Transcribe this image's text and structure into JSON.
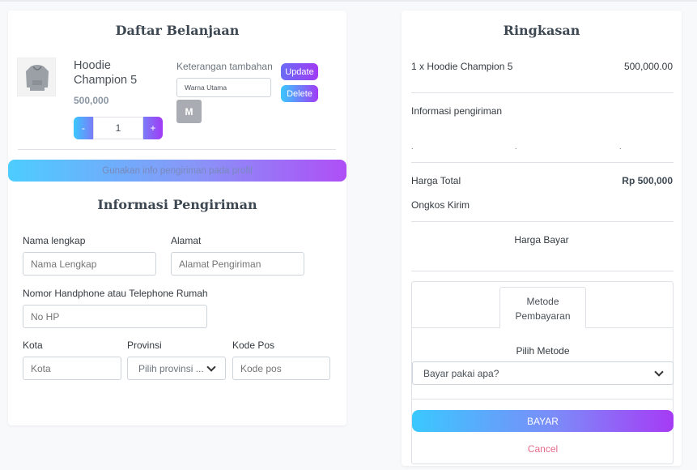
{
  "cart": {
    "title": "Daftar Belanjaan",
    "product": {
      "name": "Hoodie Champion 5",
      "price": "500,000",
      "quantity": "1",
      "image_icon": "hoodie-image"
    },
    "note_label": "Keterangan tambahan",
    "note_value": "Warna Utama",
    "m_label": "M",
    "update_label": "Update",
    "delete_label": "Delete",
    "minus_label": "-",
    "plus_label": "+",
    "profile_button": "Gunakan info pengiriman pada profil"
  },
  "shipping": {
    "title": "Informasi Pengiriman",
    "name_label": "Nama lengkap",
    "name_placeholder": "Nama Lengkap",
    "address_label": "Alamat",
    "address_placeholder": "Alamat Pengiriman",
    "phone_label": "Nomor Handphone atau Telephone Rumah",
    "phone_placeholder": "No HP",
    "city_label": "Kota",
    "city_placeholder": "Kota",
    "province_label": "Provinsi",
    "province_value": "Pilih provinsi ...",
    "zip_label": "Kode Pos",
    "zip_placeholder": "Kode pos"
  },
  "summary": {
    "title": "Ringkasan",
    "item_line": "1 x Hoodie Champion 5",
    "item_amount": "500,000.00",
    "shipping_info_label": "Informasi pengiriman",
    "dot": ".",
    "total_label": "Harga Total",
    "total_value": "Rp 500,000",
    "shipping_cost_label": "Ongkos Kirim",
    "pay_price_label": "Harga Bayar"
  },
  "payment": {
    "tab_label_line1": "Metode",
    "tab_label_line2": "Pembayaran",
    "choose_label": "Pilih Metode",
    "select_value": "Bayar pakai apa?",
    "pay_button": "BAYAR",
    "cancel_link": "Cancel"
  }
}
